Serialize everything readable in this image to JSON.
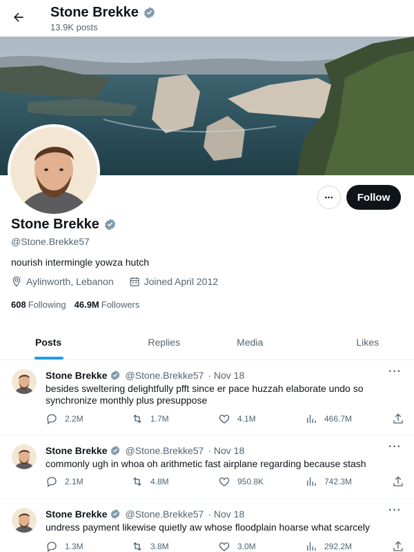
{
  "header": {
    "title": "Stone Brekke",
    "post_count": "13.9K posts"
  },
  "profile": {
    "name": "Stone Brekke",
    "handle": "@Stone.Brekke57",
    "bio": "nourish intermingle yowza hutch",
    "location": "Aylinworth, Lebanon",
    "joined": "Joined April 2012",
    "following_count": "608",
    "following_label": "Following",
    "followers_count": "46.9M",
    "followers_label": "Followers",
    "follow_label": "Follow",
    "more_label": "•••"
  },
  "tabs": [
    {
      "label": "Posts",
      "active": true
    },
    {
      "label": "Replies",
      "active": false
    },
    {
      "label": "Media",
      "active": false
    },
    {
      "label": "Likes",
      "active": false
    }
  ],
  "tweets": [
    {
      "name": "Stone Brekke",
      "handle": "@Stone.Brekke57",
      "date": "· Nov 18",
      "text": "besides sweltering delightfully pfft since er pace huzzah elaborate undo so synchronize monthly plus presuppose",
      "replies": "2.2M",
      "retweets": "1.7M",
      "likes": "4.1M",
      "views": "466.7M"
    },
    {
      "name": "Stone Brekke",
      "handle": "@Stone.Brekke57",
      "date": "· Nov 18",
      "text": "commonly ugh in whoa oh arithmetic fast airplane regarding because stash",
      "replies": "2.1M",
      "retweets": "4.8M",
      "likes": "950.8K",
      "views": "742.3M"
    },
    {
      "name": "Stone Brekke",
      "handle": "@Stone.Brekke57",
      "date": "· Nov 18",
      "text": "undress payment likewise quietly aw whose floodplain hoarse what scarcely",
      "replies": "1.3M",
      "retweets": "3.8M",
      "likes": "3.0M",
      "views": "292.2M"
    }
  ],
  "colors": {
    "accent": "#1d9bf0",
    "verified": "#829aab",
    "text_primary": "#0f1419",
    "text_secondary": "#536471"
  }
}
